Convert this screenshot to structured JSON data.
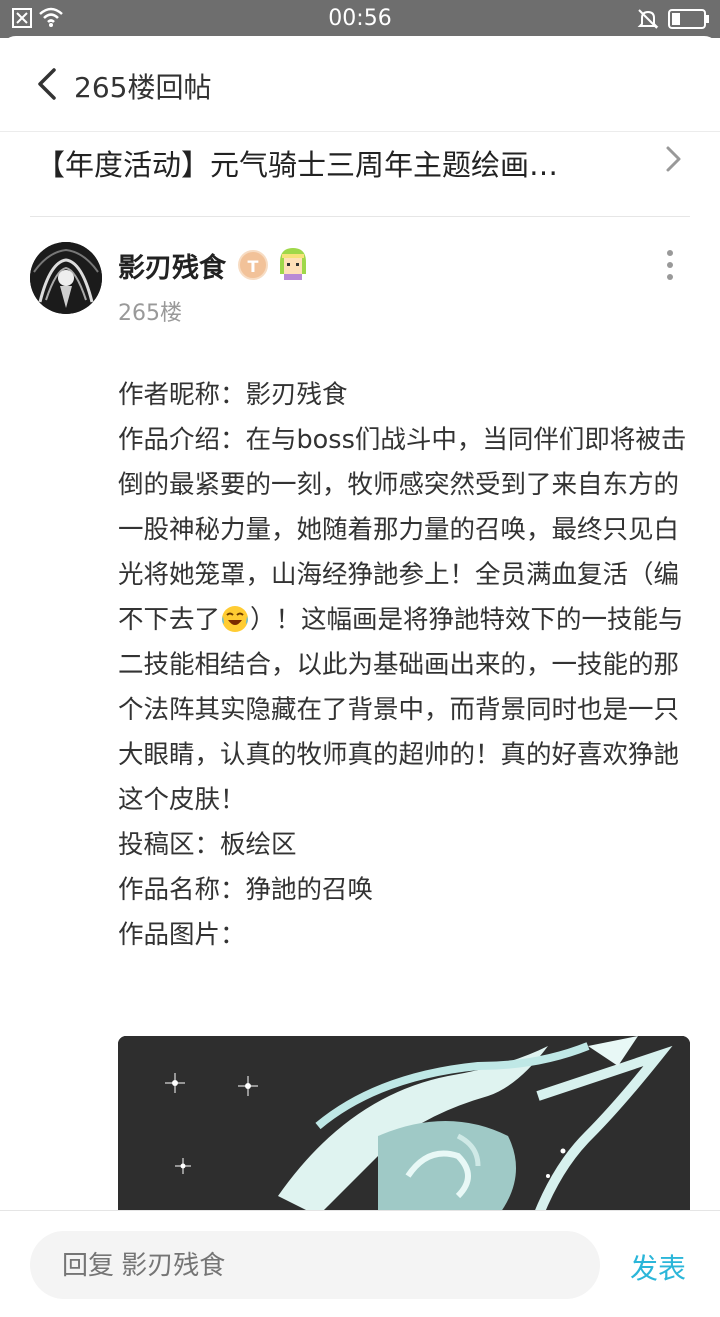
{
  "status_bar": {
    "time": "00:56"
  },
  "header": {
    "title": "265楼回帖"
  },
  "thread": {
    "title": "【年度活动】元气骑士三周年主题绘画…"
  },
  "post": {
    "username": "影刃残食",
    "level_badge": "T",
    "floor": "265楼",
    "lines": {
      "author": "作者昵称：影刃残食",
      "intro_a": "作品介绍：在与boss们战斗中，当同伴们即将被击倒的最紧要的一刻，牧师感突然受到了来自东方的一股神秘力量，她随着那力量的召唤，最终只见白光将她笼罩，山海经狰訑参上！全员满血复活（编不下去了",
      "intro_b": "）！这幅画是将狰訑特效下的一技能与二技能相结合，以此为基础画出来的，一技能的那个法阵其实隐藏在了背景中，而背景同时也是一只大眼睛，认真的牧师真的超帅的！真的好喜欢狰訑这个皮肤！",
      "section": "投稿区：板绘区",
      "name": "作品名称：狰訑的召唤",
      "image_label": "作品图片："
    }
  },
  "reply": {
    "placeholder": "回复 影刃残食",
    "send_label": "发表"
  },
  "colors": {
    "accent": "#2bb6d9",
    "status_bar": "#6e6e6e"
  }
}
